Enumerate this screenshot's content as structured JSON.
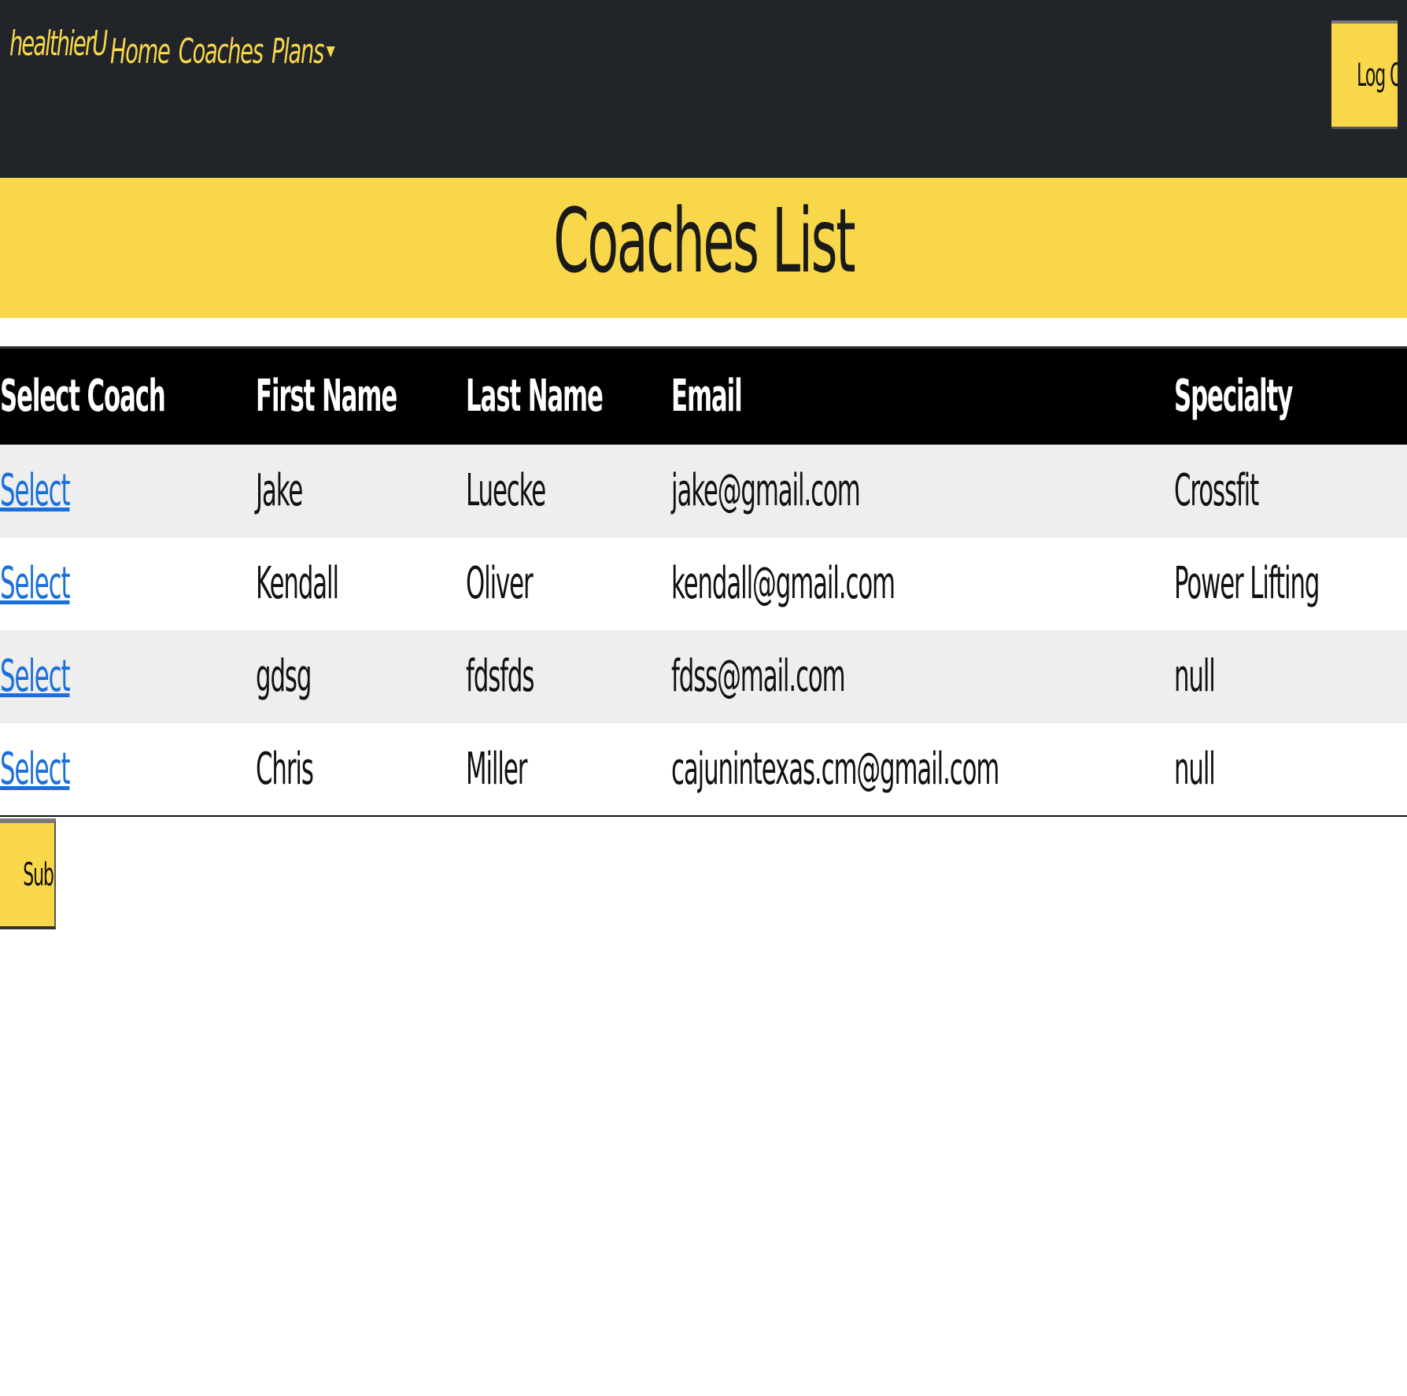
{
  "navbar": {
    "brand": "healthierU",
    "links": [
      {
        "label": "Home"
      },
      {
        "label": "Coaches"
      },
      {
        "label": "Plans"
      }
    ],
    "logout_label": "Log Out"
  },
  "banner": {
    "title": "Coaches List"
  },
  "table": {
    "headers": [
      "Select Coach",
      "First Name",
      "Last Name",
      "Email",
      "Specialty"
    ],
    "rows": [
      {
        "select": "Select",
        "first": "Jake",
        "last": "Luecke",
        "email": "jake@gmail.com",
        "specialty": "Crossfit"
      },
      {
        "select": "Select",
        "first": "Kendall",
        "last": "Oliver",
        "email": "kendall@gmail.com",
        "specialty": "Power Lifting"
      },
      {
        "select": "Select",
        "first": "gdsg",
        "last": "fdsfds",
        "email": "fdss@mail.com",
        "specialty": "null"
      },
      {
        "select": "Select",
        "first": "Chris",
        "last": "Miller",
        "email": "cajunintexas.cm@gmail.com",
        "specialty": "null"
      }
    ]
  },
  "submit_label": "Submit",
  "colors": {
    "navbar_bg": "#212529",
    "accent_yellow": "#f9d74a",
    "link_blue": "#1a6fdb",
    "table_header_bg": "#000000",
    "striped_row_bg": "#eeeeee"
  },
  "icons": {
    "plans_dropdown": "caret-down-icon"
  }
}
